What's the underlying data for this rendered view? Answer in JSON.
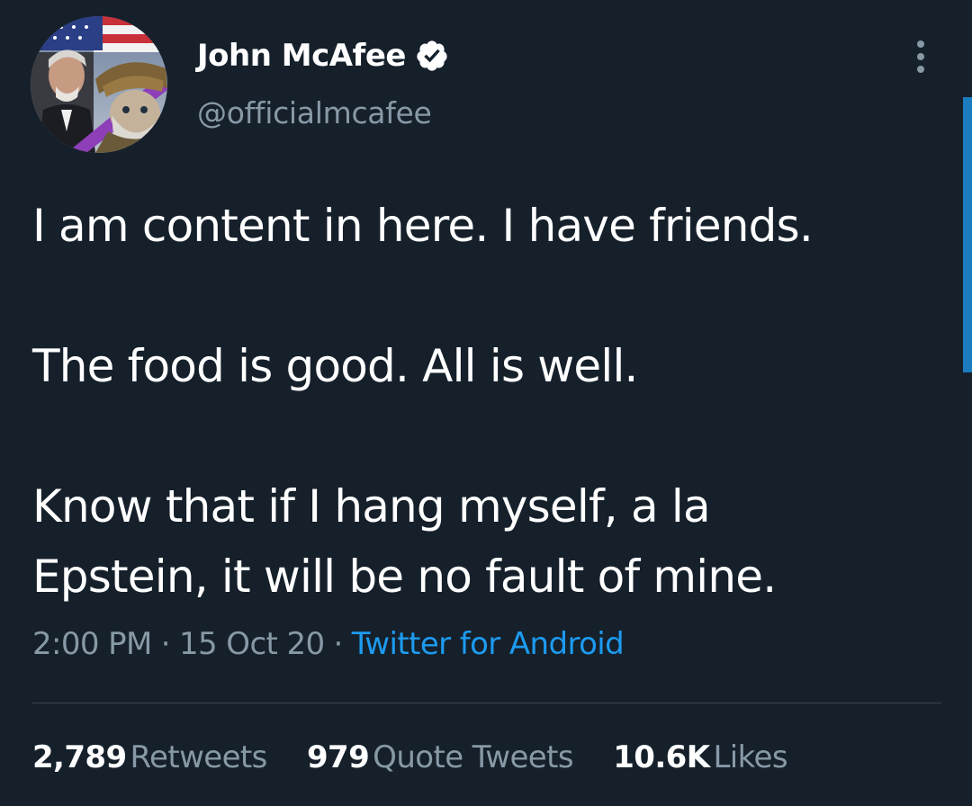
{
  "author": {
    "display_name": "John McAfee",
    "handle": "@officialmcafee",
    "verified_icon": "verified-badge-icon",
    "avatar_icon": "profile-avatar"
  },
  "tweet": {
    "paragraphs": [
      [
        "I am content in here. I have friends."
      ],
      [
        "The food is good. All is well."
      ],
      [
        "Know that if I hang myself, a la",
        "Epstein, it will be no fault of mine."
      ]
    ],
    "time": "2:00 PM",
    "date": "15 Oct 20",
    "separator": "·",
    "source": "Twitter for Android"
  },
  "stats": {
    "retweets": {
      "count": "2,789",
      "label": "Retweets"
    },
    "quote_tweets": {
      "count": "979",
      "label": "Quote Tweets"
    },
    "likes": {
      "count": "10.6K",
      "label": "Likes"
    }
  },
  "colors": {
    "background": "#15202b",
    "text": "#ffffff",
    "secondary_text": "#8899a6",
    "accent": "#1d9bf0",
    "divider": "#38444d"
  },
  "icons": {
    "more": "more-vertical-icon"
  }
}
